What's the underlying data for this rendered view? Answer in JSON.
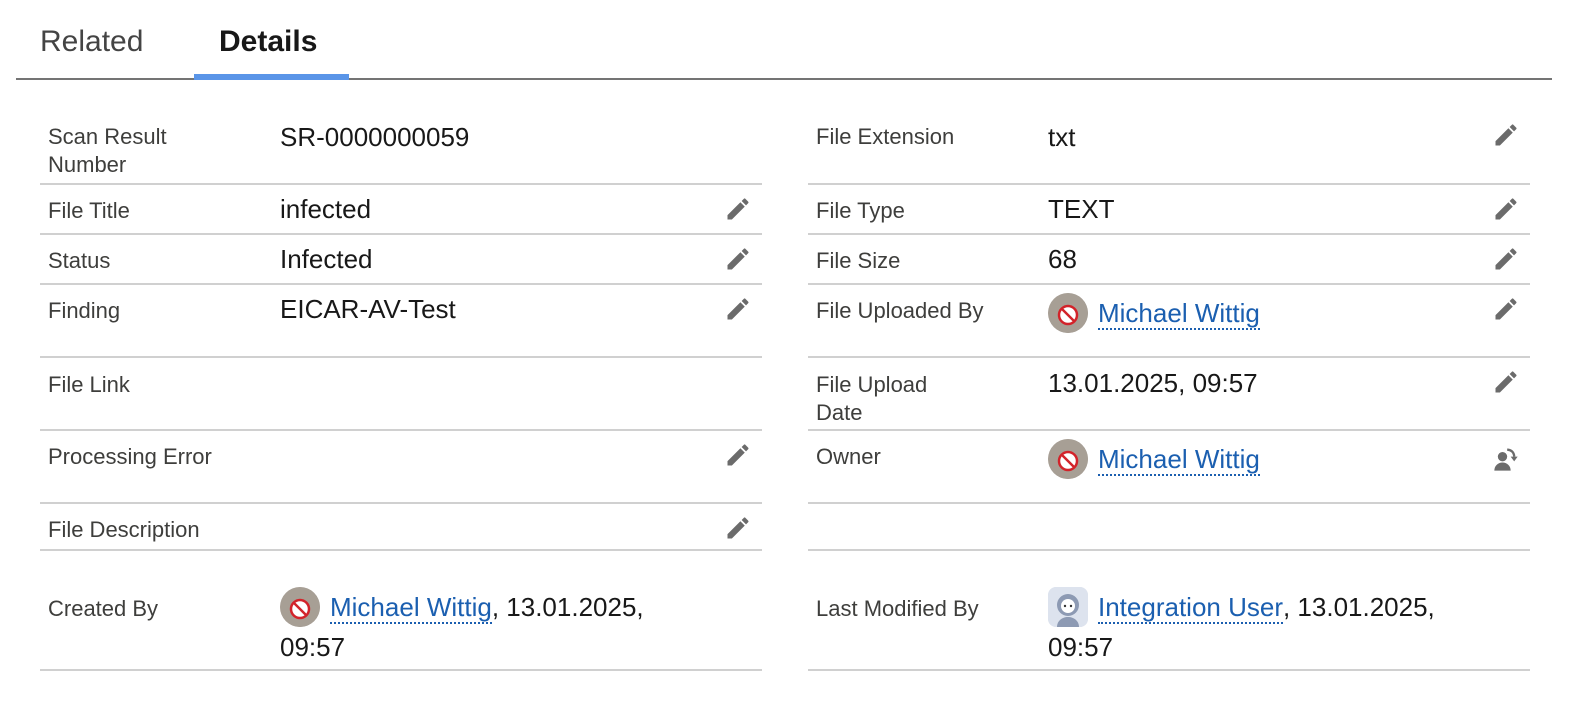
{
  "tabs": [
    {
      "label": "Related",
      "active": false
    },
    {
      "label": "Details",
      "active": true
    }
  ],
  "accent_color": "#5a95e8",
  "link_color": "#1b5fb0",
  "left_fields": [
    {
      "label": "Scan Result Number",
      "value": "SR-0000000059",
      "editable": false
    },
    {
      "label": "File Title",
      "value": "infected",
      "editable": true
    },
    {
      "label": "Status",
      "value": "Infected",
      "editable": true
    },
    {
      "label": "Finding",
      "value": "EICAR-AV-Test",
      "editable": true
    },
    {
      "label": "File Link",
      "value": "",
      "editable": false
    },
    {
      "label": "Processing Error",
      "value": "",
      "editable": true
    },
    {
      "label": "File Description",
      "value": "",
      "editable": true
    }
  ],
  "right_fields": [
    {
      "label": "File Extension",
      "value": "txt",
      "editable": true
    },
    {
      "label": "File Type",
      "value": "TEXT",
      "editable": true
    },
    {
      "label": "File Size",
      "value": "68",
      "editable": true
    },
    {
      "label": "File Uploaded By",
      "user": "Michael Wittig",
      "editable": true
    },
    {
      "label": "File Upload Date",
      "value": "13.01.2025, 09:57",
      "editable": true
    },
    {
      "label": "Owner",
      "user": "Michael Wittig",
      "action": "change-owner"
    }
  ],
  "created_by": {
    "label": "Created By",
    "user": "Michael Wittig",
    "timestamp_line1": ", 13.01.2025,",
    "timestamp_line2": "09:57"
  },
  "last_modified_by": {
    "label": "Last Modified By",
    "user": "Integration User",
    "timestamp_line1": ", 13.01.2025,",
    "timestamp_line2": "09:57"
  }
}
